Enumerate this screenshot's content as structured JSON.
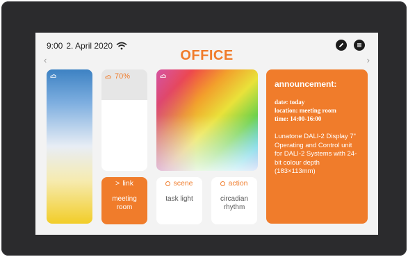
{
  "status": {
    "time": "9:00",
    "date": "2. April 2020",
    "wifi_icon": "wifi-icon"
  },
  "header": {
    "title": "OFFICE",
    "prev_icon": "chevron-left-icon",
    "next_icon": "chevron-right-icon",
    "edit_icon": "pencil-icon",
    "menu_icon": "menu-icon"
  },
  "controls": {
    "temperature_icon": "cloud-icon",
    "dimmer": {
      "label": "70%",
      "level": 0.7,
      "icon": "cloud-icon"
    },
    "color_icon": "cloud-icon"
  },
  "tiles": {
    "link": {
      "label": "link",
      "value": "meeting room",
      "icon": "chevron-right-icon"
    },
    "scene": {
      "label": "scene",
      "value": "task light",
      "icon": "circle-icon"
    },
    "action": {
      "label": "action",
      "value": "circadian rhythm",
      "icon": "circle-icon"
    }
  },
  "announcement": {
    "title": "announcement:",
    "date": "date: today",
    "location": "location: meeting room",
    "time": "time: 14:00-16:00",
    "description": "Lunatone DALI-2 Display 7\" Operating and Control unit for DALI-2 Systems with 24-bit colour depth (183×113mm)"
  },
  "colors": {
    "accent": "#f07c2b",
    "bezel": "#2b2b2d",
    "screen_bg": "#f3f3f3"
  }
}
